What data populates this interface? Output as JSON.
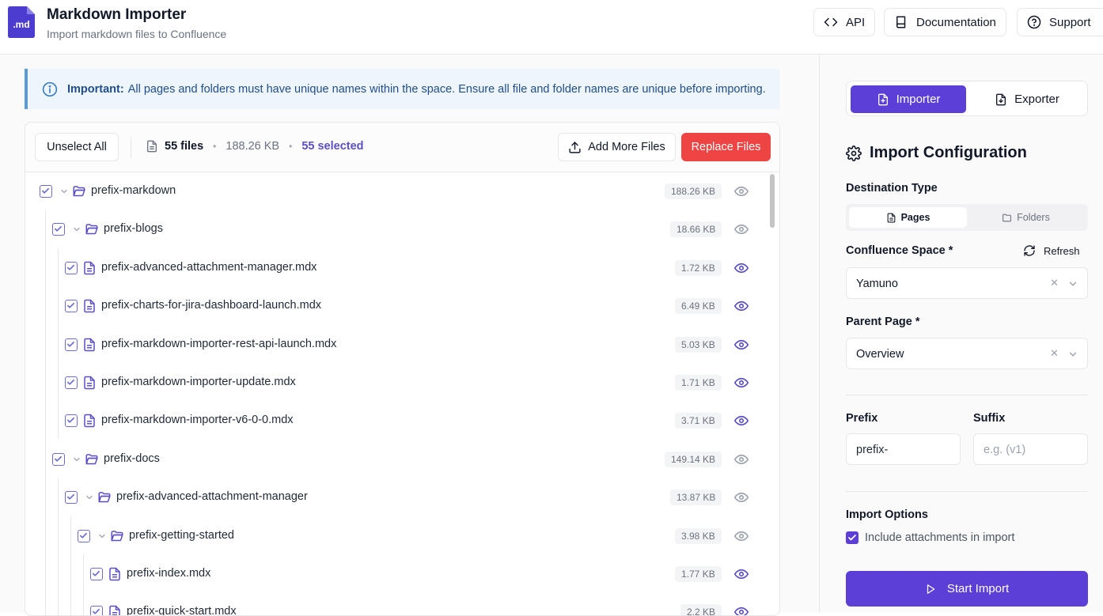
{
  "app": {
    "title": "Markdown Importer",
    "subtitle": "Import markdown files to Confluence",
    "logo_text": ".md"
  },
  "header_buttons": {
    "api": "API",
    "docs": "Documentation",
    "support": "Support"
  },
  "notice": {
    "strong": "Important:",
    "text": "All pages and folders must have unique names within the space. Ensure all file and folder names are unique before importing."
  },
  "toolbar": {
    "unselect": "Unselect All",
    "files": "55 files",
    "size": "188.26 KB",
    "selected": "55 selected",
    "add_more": "Add More Files",
    "replace": "Replace Files"
  },
  "tree": [
    {
      "type": "folder",
      "name": "prefix-markdown",
      "size": "188.26 KB",
      "depth": 0
    },
    {
      "type": "folder",
      "name": "prefix-blogs",
      "size": "18.66 KB",
      "depth": 1
    },
    {
      "type": "file",
      "name": "prefix-advanced-attachment-manager.mdx",
      "size": "1.72 KB",
      "depth": 2
    },
    {
      "type": "file",
      "name": "prefix-charts-for-jira-dashboard-launch.mdx",
      "size": "6.49 KB",
      "depth": 2
    },
    {
      "type": "file",
      "name": "prefix-markdown-importer-rest-api-launch.mdx",
      "size": "5.03 KB",
      "depth": 2
    },
    {
      "type": "file",
      "name": "prefix-markdown-importer-update.mdx",
      "size": "1.71 KB",
      "depth": 2
    },
    {
      "type": "file",
      "name": "prefix-markdown-importer-v6-0-0.mdx",
      "size": "3.71 KB",
      "depth": 2
    },
    {
      "type": "folder",
      "name": "prefix-docs",
      "size": "149.14 KB",
      "depth": 1
    },
    {
      "type": "folder",
      "name": "prefix-advanced-attachment-manager",
      "size": "13.87 KB",
      "depth": 2
    },
    {
      "type": "folder",
      "name": "prefix-getting-started",
      "size": "3.98 KB",
      "depth": 3
    },
    {
      "type": "file",
      "name": "prefix-index.mdx",
      "size": "1.77 KB",
      "depth": 4
    },
    {
      "type": "file",
      "name": "prefix-quick-start.mdx",
      "size": "2.2 KB",
      "depth": 4
    }
  ],
  "sidebar": {
    "tab_importer": "Importer",
    "tab_exporter": "Exporter",
    "config_title": "Import Configuration",
    "destination_label": "Destination Type",
    "dest_pages": "Pages",
    "dest_folders": "Folders",
    "space_label": "Confluence Space *",
    "refresh": "Refresh",
    "space_value": "Yamuno",
    "parent_label": "Parent Page *",
    "parent_value": "Overview",
    "prefix_label": "Prefix",
    "suffix_label": "Suffix",
    "prefix_value": "prefix-",
    "suffix_placeholder": "e.g. (v1)",
    "options_label": "Import Options",
    "attachments_label": "Include attachments in import",
    "start": "Start Import"
  }
}
